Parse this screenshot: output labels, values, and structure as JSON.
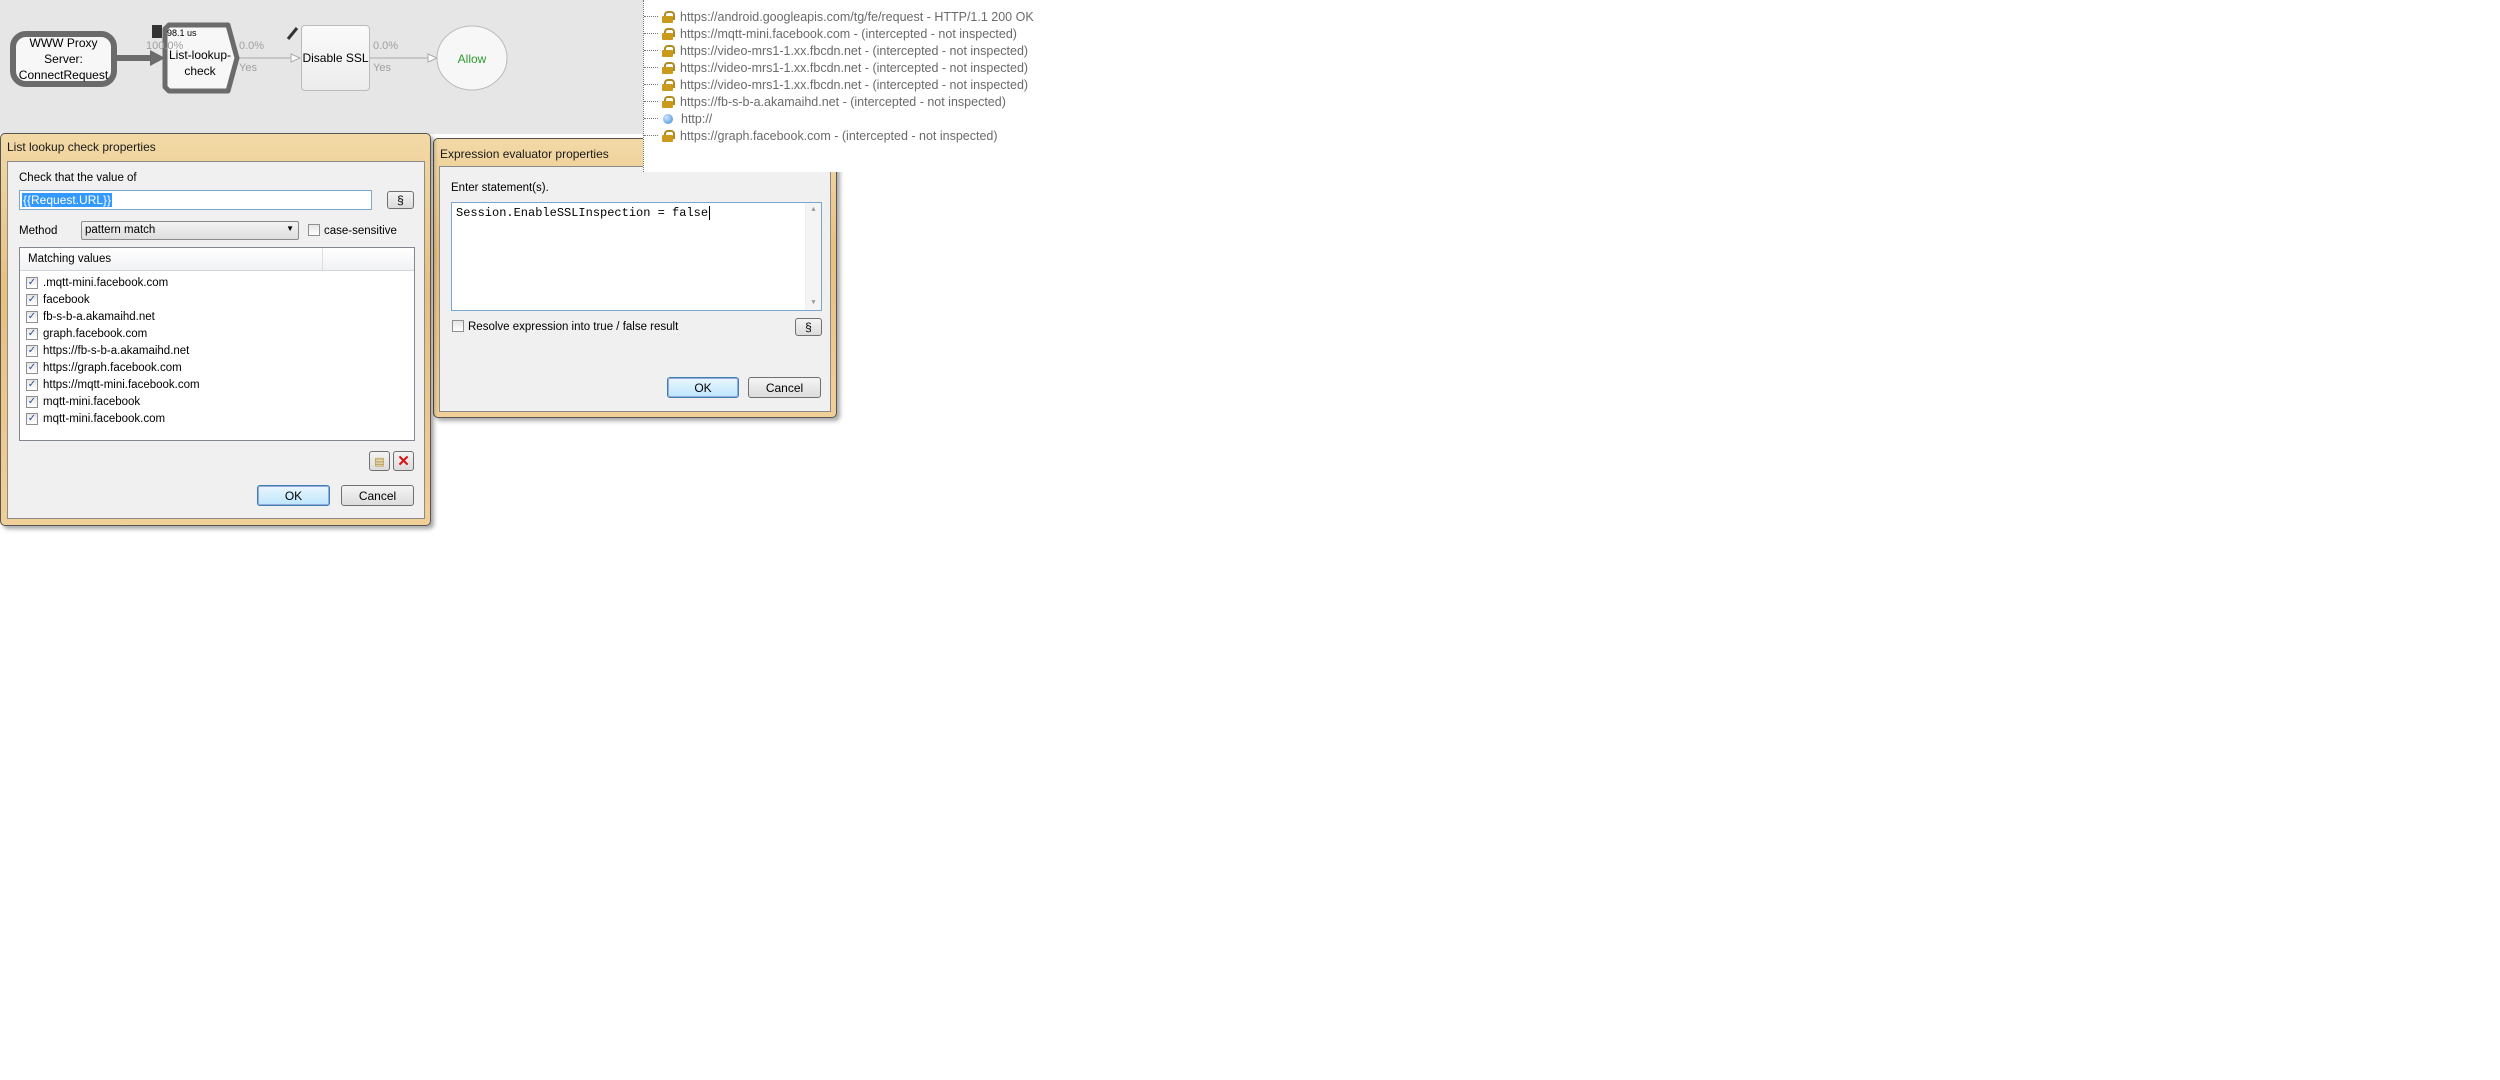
{
  "diagram": {
    "nodes": {
      "proxy": "WWW Proxy Server:\nConnectRequest",
      "lookup": "List-lookup-\ncheck",
      "lookup_time": "98.1 us",
      "disable_ssl": "Disable SSL",
      "allow": "Allow"
    },
    "edges": [
      {
        "pct": "100.0%"
      },
      {
        "pct": "0.0%",
        "label": "Yes"
      },
      {
        "pct": "0.0%",
        "label": "Yes"
      }
    ],
    "allow_color": "#2e9b2e"
  },
  "tree": {
    "items": [
      {
        "icon": "lock-icon",
        "text": "https://android.googleapis.com/tg/fe/request - HTTP/1.1 200 OK"
      },
      {
        "icon": "lock-icon",
        "text": "https://mqtt-mini.facebook.com - (intercepted - not inspected)"
      },
      {
        "icon": "lock-icon",
        "text": "https://video-mrs1-1.xx.fbcdn.net - (intercepted - not inspected)"
      },
      {
        "icon": "lock-icon",
        "text": "https://video-mrs1-1.xx.fbcdn.net - (intercepted - not inspected)"
      },
      {
        "icon": "lock-icon",
        "text": "https://video-mrs1-1.xx.fbcdn.net - (intercepted - not inspected)"
      },
      {
        "icon": "lock-icon",
        "text": "https://fb-s-b-a.akamaihd.net - (intercepted - not inspected)"
      },
      {
        "icon": "globe-icon",
        "text": "http://"
      },
      {
        "icon": "lock-icon",
        "text": "https://graph.facebook.com - (intercepted - not inspected)"
      }
    ]
  },
  "list_dialog": {
    "title": "List lookup check properties",
    "check_label": "Check that the value of",
    "value": "{{Request.URL}}",
    "section_button": "§",
    "method_label": "Method",
    "method_value": "pattern match",
    "case_sensitive_label": "case-sensitive",
    "case_sensitive": false,
    "column_header": "Matching values",
    "values": [
      {
        "text": ".mqtt-mini.facebook.com",
        "checked": true
      },
      {
        "text": "facebook",
        "checked": true
      },
      {
        "text": "fb-s-b-a.akamaihd.net",
        "checked": true
      },
      {
        "text": "graph.facebook.com",
        "checked": true
      },
      {
        "text": "https://fb-s-b-a.akamaihd.net",
        "checked": true
      },
      {
        "text": "https://graph.facebook.com",
        "checked": true
      },
      {
        "text": "https://mqtt-mini.facebook.com",
        "checked": true
      },
      {
        "text": "mqtt-mini.facebook",
        "checked": true
      },
      {
        "text": "mqtt-mini.facebook.com",
        "checked": true
      }
    ],
    "ok": "OK",
    "cancel": "Cancel"
  },
  "expr_dialog": {
    "title": "Expression evaluator properties",
    "prompt": "Enter statement(s).",
    "statement": "Session.EnableSSLInspection = false",
    "resolve_label": "Resolve expression into true / false result",
    "resolve": false,
    "section_button": "§",
    "ok": "OK",
    "cancel": "Cancel"
  }
}
